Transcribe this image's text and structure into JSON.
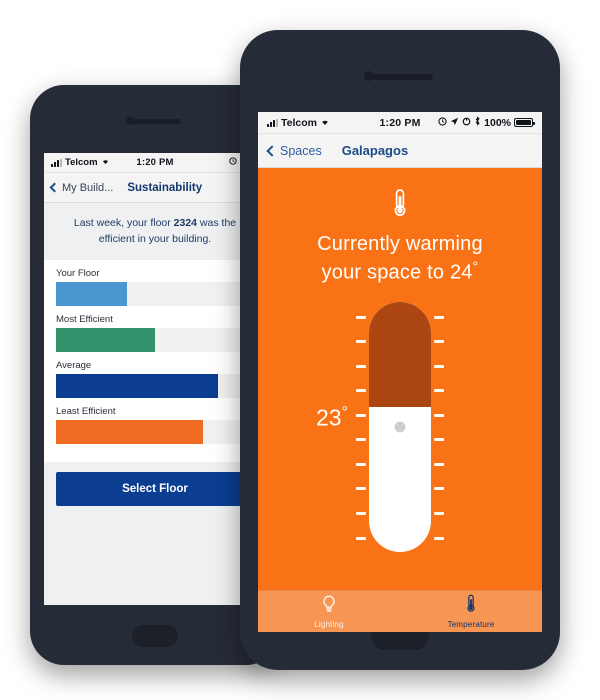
{
  "back_phone": {
    "status_bar": {
      "carrier": "Telcom",
      "time": "1:20 PM",
      "battery_text": ""
    },
    "nav": {
      "back_label": "My Build...",
      "title": "Sustainability"
    },
    "message": {
      "line1_prefix": "Last week, your floor ",
      "floor_number": "2324",
      "line1_suffix": " was the",
      "line2": "efficient in your building."
    },
    "bars": [
      {
        "label": "Your Floor",
        "percent": 36,
        "color": "#4a96ce"
      },
      {
        "label": "Most Efficient",
        "percent": 50,
        "color": "#33926c"
      },
      {
        "label": "Average",
        "percent": 82,
        "color": "#0b3d91"
      },
      {
        "label": "Least Efficient",
        "percent": 74,
        "color": "#ef6c23"
      }
    ],
    "select_floor_label": "Select Floor"
  },
  "front_phone": {
    "status_bar": {
      "carrier": "Telcom",
      "time": "1:20 PM",
      "battery_text": "100%"
    },
    "nav": {
      "back_label": "Spaces",
      "title": "Galapagos"
    },
    "heading": {
      "line1": "Currently warming",
      "line2_prefix": "your space to 24",
      "degree": "°"
    },
    "thermostat": {
      "current_temp": "23",
      "degree": "°",
      "target_temp": "24",
      "fill_percent": 42,
      "knob_percent": 50,
      "tick_count": 10
    },
    "tabs": [
      {
        "label": "Lighting",
        "icon": "lightbulb-icon",
        "active": false
      },
      {
        "label": "Temperature",
        "icon": "thermometer-icon",
        "active": true
      }
    ],
    "accent_color": "#f97316",
    "fill_color": "#ab4511",
    "tabbar_color": "#f79553"
  }
}
